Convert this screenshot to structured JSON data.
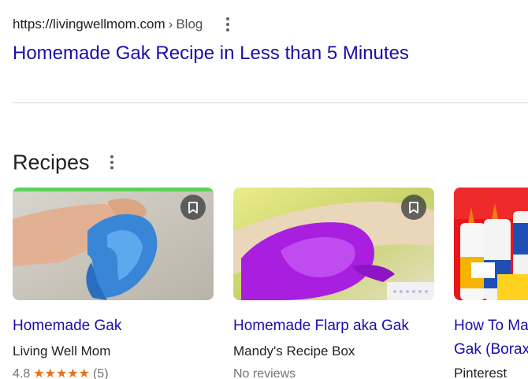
{
  "result": {
    "url": "https://livingwellmom.com",
    "separator": "›",
    "path": "Blog",
    "title": "Homemade Gak Recipe in Less than 5 Minutes"
  },
  "section": {
    "title": "Recipes"
  },
  "cards": [
    {
      "title": "Homemade Gak",
      "source": "Living Well Mom",
      "rating": "4.8",
      "stars": "★★★★★",
      "reviews": "(5)",
      "accent": "#5bd35b"
    },
    {
      "title": "Homemade Flarp aka Gak",
      "source": "Mandy's Recipe Box",
      "reviews_text": "No reviews"
    },
    {
      "title_line1": "How To Ma",
      "title_line2": "Gak (Borax",
      "source": "Pinterest"
    }
  ],
  "colors": {
    "link": "#1a0dab",
    "star": "#e7711b",
    "divider": "#dadce0"
  }
}
